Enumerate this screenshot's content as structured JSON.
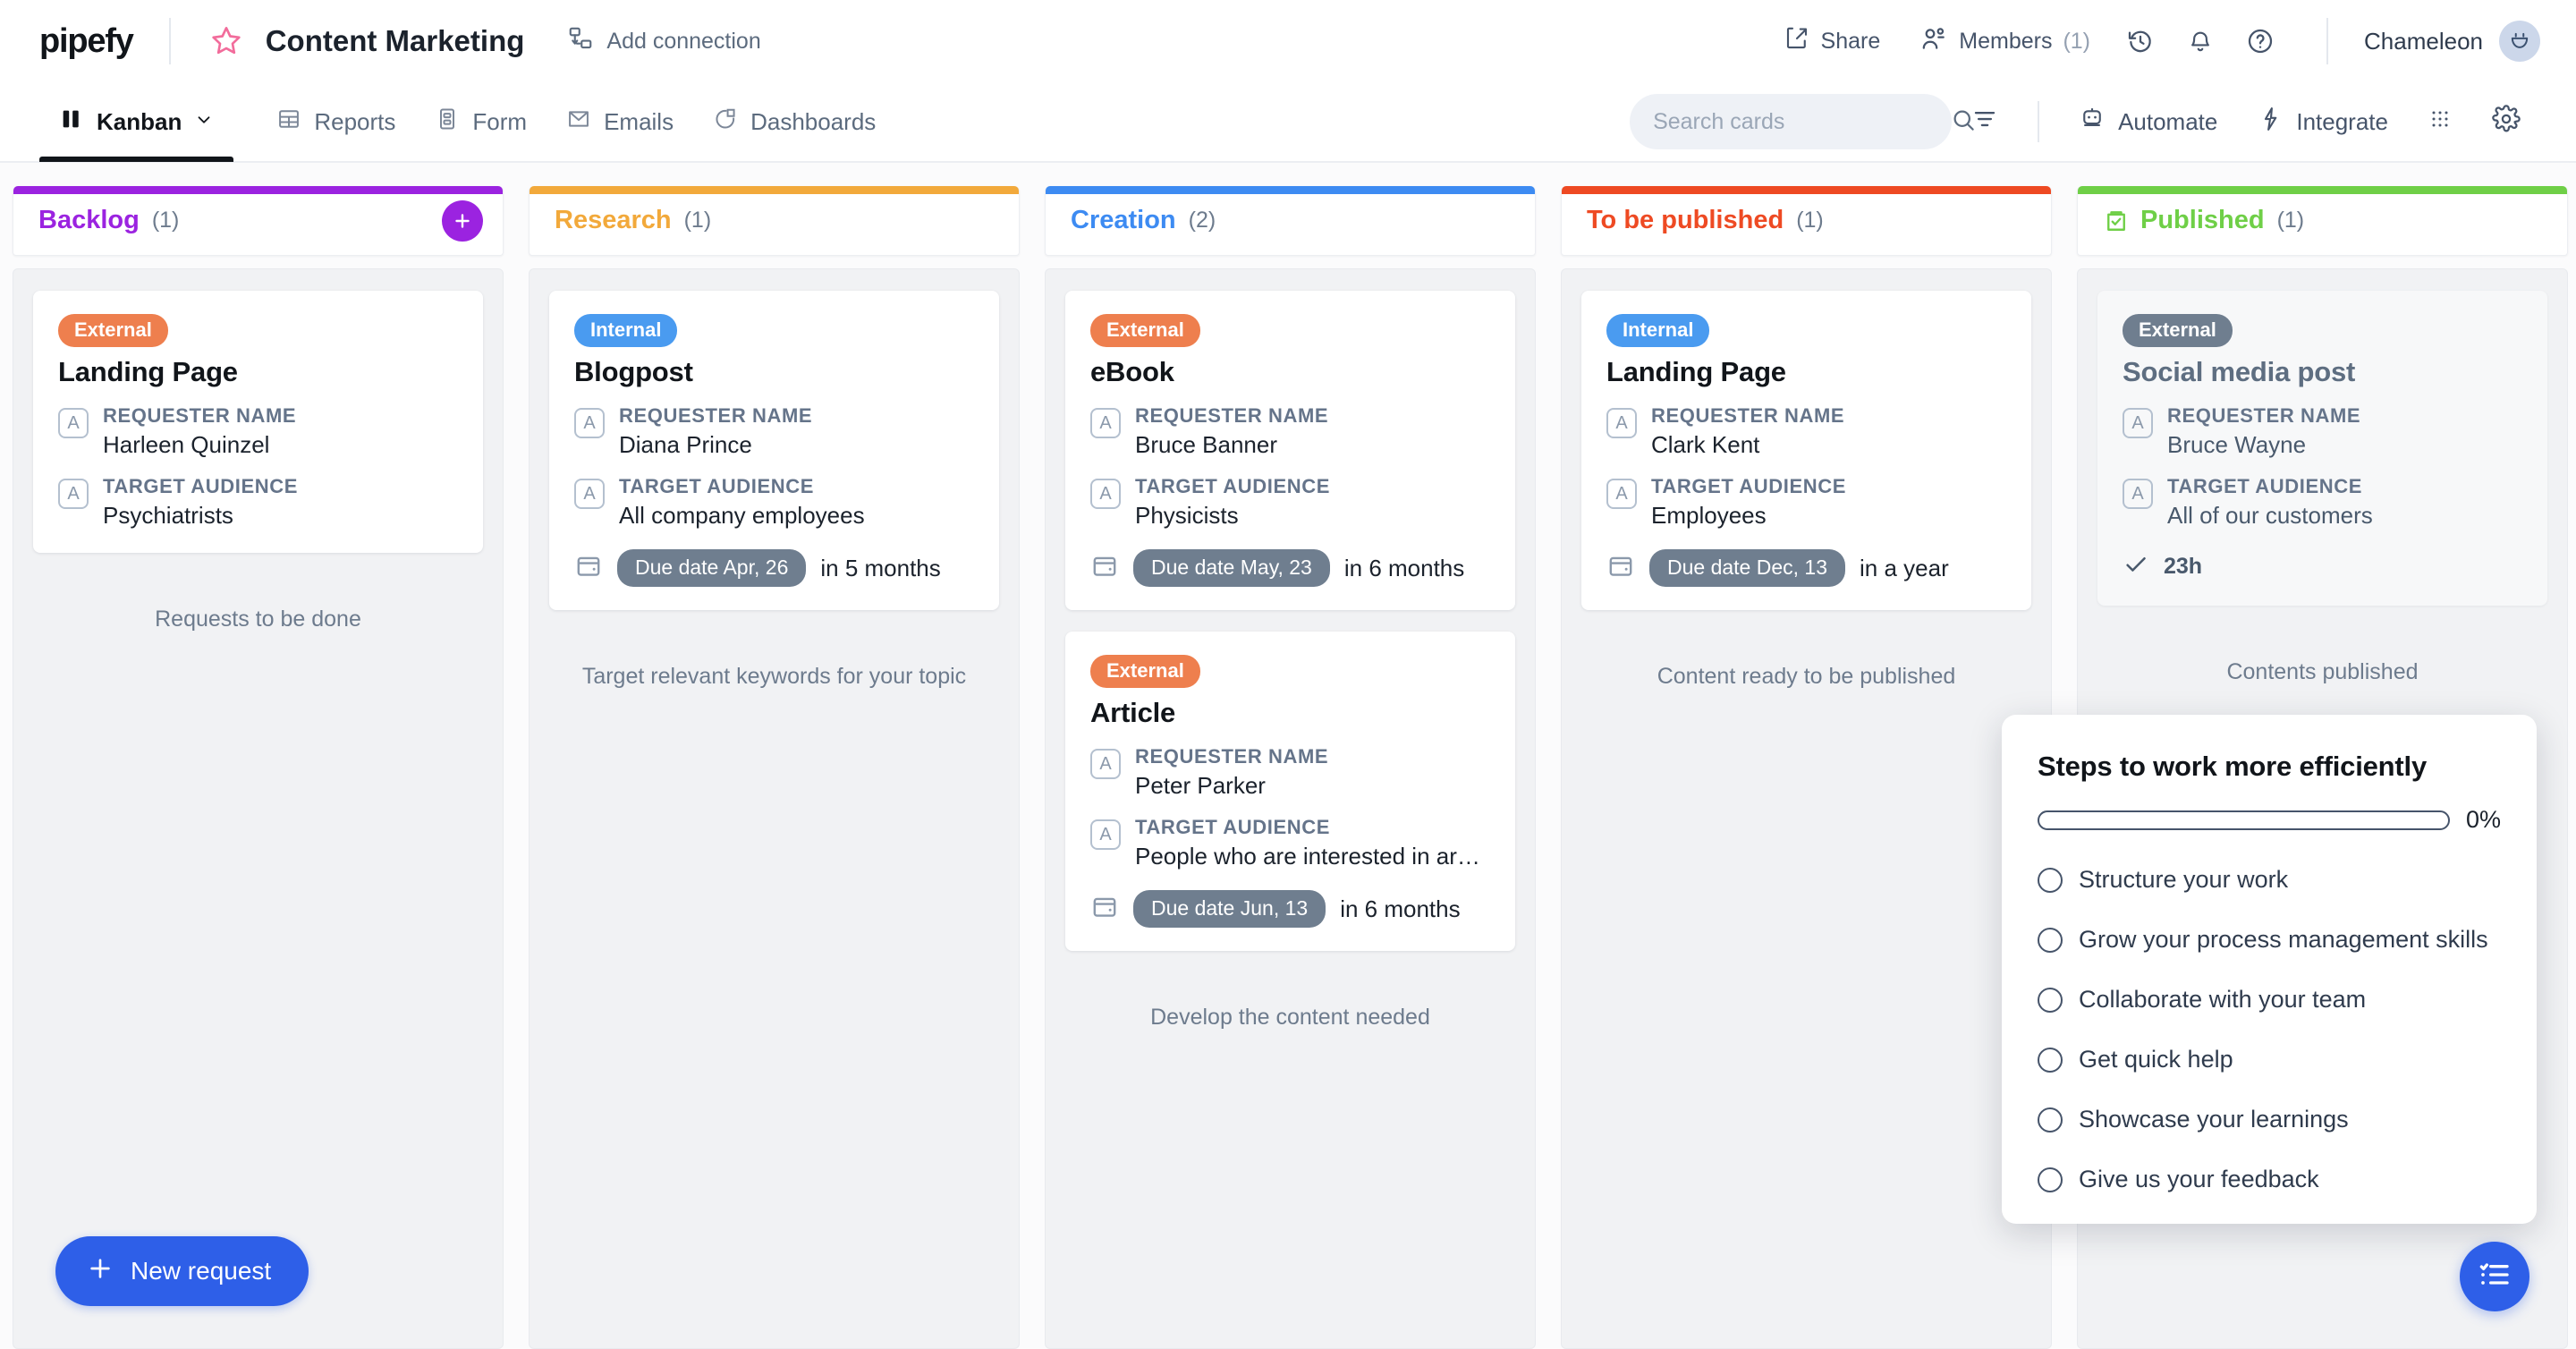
{
  "header": {
    "logo": "pipefy",
    "pipe_title": "Content Marketing",
    "add_connection": "Add connection",
    "share": "Share",
    "members": "Members",
    "members_count": "(1)",
    "user_name": "Chameleon",
    "icons": {
      "star": "star-icon",
      "connection": "connection-icon",
      "share": "share-icon",
      "members": "members-icon",
      "history": "history-icon",
      "bell": "bell-icon",
      "help": "help-icon",
      "avatar": "smiley-avatar-icon"
    }
  },
  "toolbar": {
    "tabs": [
      {
        "label": "Kanban",
        "icon": "kanban-icon",
        "active": true,
        "has_chevron": true
      },
      {
        "label": "Reports",
        "icon": "reports-icon",
        "active": false
      },
      {
        "label": "Form",
        "icon": "form-icon",
        "active": false
      },
      {
        "label": "Emails",
        "icon": "emails-icon",
        "active": false
      },
      {
        "label": "Dashboards",
        "icon": "dashboards-icon",
        "active": false
      }
    ],
    "search_placeholder": "Search cards",
    "search_value": "",
    "filter_icon": "filter-icon",
    "automate": "Automate",
    "integrate": "Integrate",
    "apps_icon": "apps-grid-icon",
    "settings_icon": "gear-icon"
  },
  "colors": {
    "backlog": "#9B23E0",
    "research": "#F2A93B",
    "creation": "#3D8BF2",
    "to_be_published": "#EE4A23",
    "published": "#6FCF47",
    "badge_external": "#EE7F4E",
    "badge_internal": "#4A9BF0",
    "badge_done": "#6F7E8F",
    "due_pill": "#6F7E8F",
    "primary_blue": "#2E5FE8"
  },
  "board": {
    "columns": [
      {
        "name": "Backlog",
        "count": "(1)",
        "accent": "#9B23E0",
        "name_color": "#9B23E0",
        "has_add": true,
        "icon": null,
        "hint": "Requests to be done",
        "cards": [
          {
            "badge": "External",
            "badge_type": "external",
            "title": "Landing Page",
            "fields": [
              {
                "icon": "A",
                "label": "REQUESTER NAME",
                "value": "Harleen Quinzel"
              },
              {
                "icon": "A",
                "label": "TARGET AUDIENCE",
                "value": "Psychiatrists"
              }
            ],
            "due_pill": null,
            "due_rel": null,
            "done_time": null
          }
        ]
      },
      {
        "name": "Research",
        "count": "(1)",
        "accent": "#F2A93B",
        "name_color": "#F2A93B",
        "has_add": false,
        "icon": null,
        "hint": "Target relevant keywords for your topic",
        "cards": [
          {
            "badge": "Internal",
            "badge_type": "internal",
            "title": "Blogpost",
            "fields": [
              {
                "icon": "A",
                "label": "REQUESTER NAME",
                "value": "Diana Prince"
              },
              {
                "icon": "A",
                "label": "TARGET AUDIENCE",
                "value": "All company employees"
              }
            ],
            "due_pill": "Due date Apr, 26",
            "due_rel": "in 5 months",
            "done_time": null
          }
        ]
      },
      {
        "name": "Creation",
        "count": "(2)",
        "accent": "#3D8BF2",
        "name_color": "#3D8BF2",
        "has_add": false,
        "icon": null,
        "hint": "Develop the content needed",
        "cards": [
          {
            "badge": "External",
            "badge_type": "external",
            "title": "eBook",
            "fields": [
              {
                "icon": "A",
                "label": "REQUESTER NAME",
                "value": "Bruce Banner"
              },
              {
                "icon": "A",
                "label": "TARGET AUDIENCE",
                "value": "Physicists"
              }
            ],
            "due_pill": "Due date May, 23",
            "due_rel": "in 6 months",
            "done_time": null
          },
          {
            "badge": "External",
            "badge_type": "external",
            "title": "Article",
            "fields": [
              {
                "icon": "A",
                "label": "REQUESTER NAME",
                "value": "Peter Parker"
              },
              {
                "icon": "A",
                "label": "TARGET AUDIENCE",
                "value": "People who are interested in arach..."
              }
            ],
            "due_pill": "Due date Jun, 13",
            "due_rel": "in 6 months",
            "done_time": null
          }
        ]
      },
      {
        "name": "To be published",
        "count": "(1)",
        "accent": "#EE4A23",
        "name_color": "#EE4A23",
        "has_add": false,
        "icon": null,
        "hint": "Content ready to be published",
        "cards": [
          {
            "badge": "Internal",
            "badge_type": "internal",
            "title": "Landing Page",
            "fields": [
              {
                "icon": "A",
                "label": "REQUESTER NAME",
                "value": "Clark Kent"
              },
              {
                "icon": "A",
                "label": "TARGET AUDIENCE",
                "value": "Employees"
              }
            ],
            "due_pill": "Due date Dec, 13",
            "due_rel": "in a year",
            "done_time": null
          }
        ]
      },
      {
        "name": "Published",
        "count": "(1)",
        "accent": "#6FCF47",
        "name_color": "#6FCF47",
        "has_add": false,
        "icon": "checkbox-done-icon",
        "hint": "Contents published",
        "cards": [
          {
            "badge": "External",
            "badge_type": "done",
            "title": "Social media post",
            "done": true,
            "fields": [
              {
                "icon": "A",
                "label": "REQUESTER NAME",
                "value": "Bruce Wayne"
              },
              {
                "icon": "A",
                "label": "TARGET AUDIENCE",
                "value": "All of our customers"
              }
            ],
            "due_pill": null,
            "due_rel": null,
            "done_time": "23h"
          }
        ]
      }
    ]
  },
  "new_request_button": "New request",
  "onboarding": {
    "title": "Steps to work more efficiently",
    "progress_pct": "0%",
    "progress_value": 0,
    "steps": [
      "Structure your work",
      "Grow your process management skills",
      "Collaborate with your team",
      "Get quick help",
      "Showcase your learnings",
      "Give us your feedback"
    ]
  },
  "fab_icon": "checklist-icon"
}
